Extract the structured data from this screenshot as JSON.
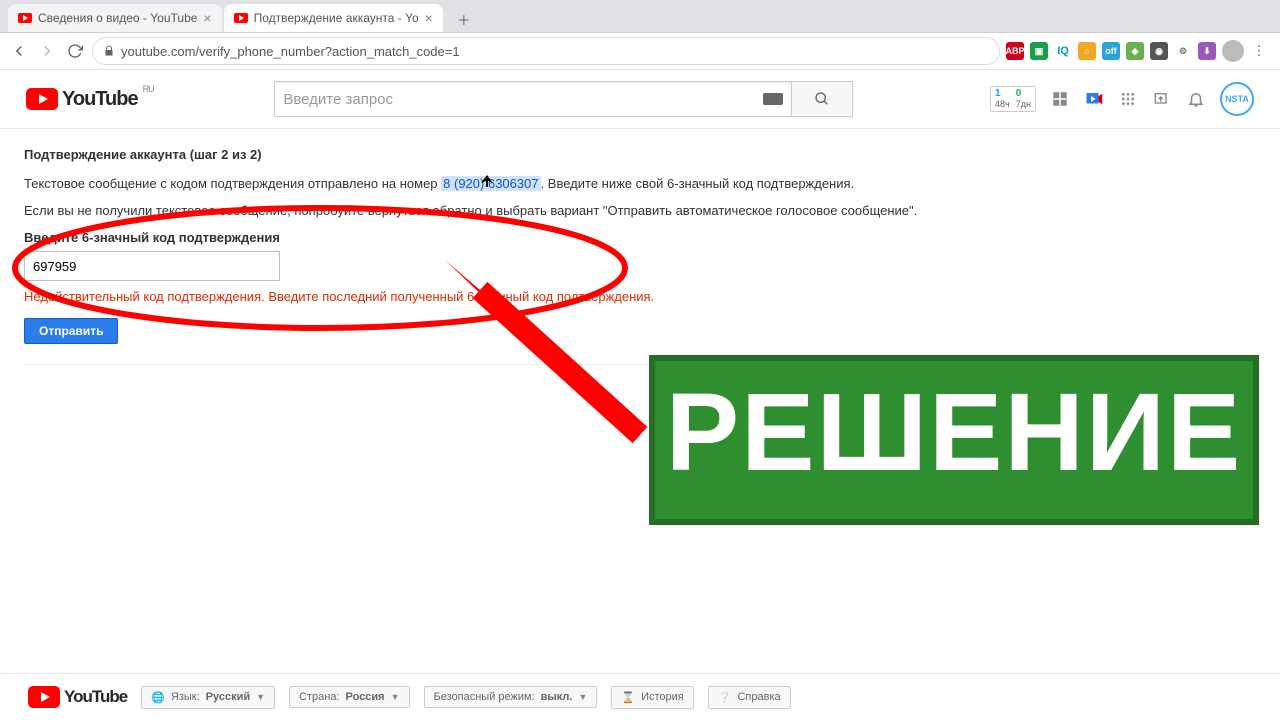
{
  "browser": {
    "tabs": [
      {
        "title": "Сведения о видео - YouTube"
      },
      {
        "title": "Подтверждение аккаунта - Yo"
      }
    ],
    "url": "youtube.com/verify_phone_number?action_match_code=1"
  },
  "youtube": {
    "brand": "YouTube",
    "region_sup": "RU",
    "search_placeholder": "Введите запрос",
    "stats": {
      "left_num": "1",
      "left_lbl": "48ч",
      "right_num": "0",
      "right_lbl": "7дн"
    },
    "user_chip": "NSTA"
  },
  "verify": {
    "title": "Подтверждение аккаунта (шаг 2 из 2)",
    "line1_prefix": "Текстовое сообщение с кодом подтверждения отправлено на номер ",
    "phone": "8 (920) 6306307",
    "line1_suffix": ". Введите ниже свой 6-значный код подтверждения.",
    "line2": "Если вы не получили текстовое сообщение, попробуйте вернуться обратно и выбрать вариант \"Отправить автоматическое голосовое сообщение\".",
    "field_label": "Введите 6-значный код подтверждения",
    "code_value": "697959",
    "error": "Недействительный код подтверждения. Введите последний полученный 6-значный код подтверждения.",
    "submit": "Отправить"
  },
  "overlay": {
    "green_text": "РЕШЕНИЕ"
  },
  "footer": {
    "lang_label": "Язык:",
    "lang_value": "Русский",
    "country_label": "Страна:",
    "country_value": "Россия",
    "safe_label": "Безопасный режим:",
    "safe_value": "выкл.",
    "history": "История",
    "help": "Справка"
  }
}
